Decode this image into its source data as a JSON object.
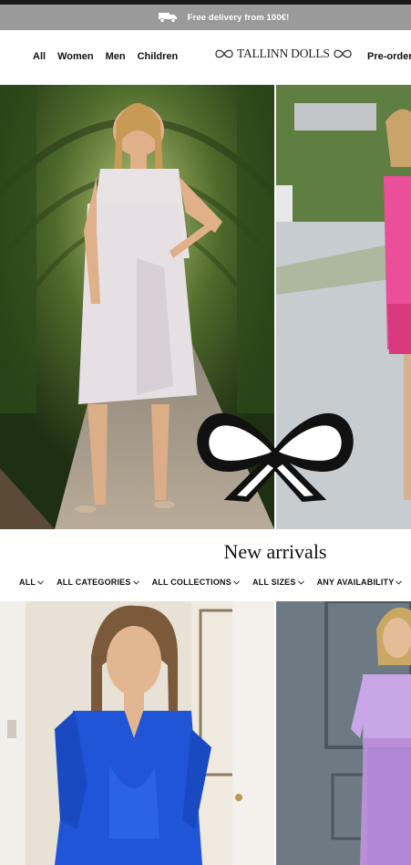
{
  "promo": {
    "icon": "truck-icon",
    "text": "Free delivery from 100€!"
  },
  "nav": {
    "items": [
      "All",
      "Women",
      "Men",
      "Children"
    ],
    "preorder": "Pre-order"
  },
  "logo": {
    "text": "TALLINN DOLLS"
  },
  "hero": {
    "bow_icon": "bow-logo-icon"
  },
  "section": {
    "title": "New arrivals"
  },
  "filters": [
    "ALL",
    "ALL CATEGORIES",
    "ALL COLLECTIONS",
    "ALL SIZES",
    "ANY AVAILABILITY"
  ],
  "colors": {
    "promo_bg": "#9a9a9a",
    "dress_blue": "#1f55d6",
    "dress_lilac": "#c9a6e6",
    "dress_pink": "#ec4f9a",
    "dress_white": "#e9e3e6"
  }
}
